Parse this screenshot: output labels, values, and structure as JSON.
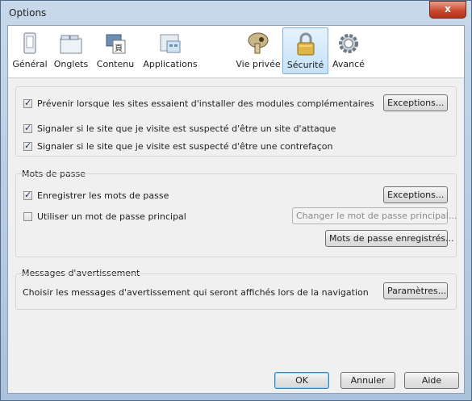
{
  "window": {
    "title": "Options",
    "close_glyph": "x"
  },
  "tabs": [
    {
      "label": "Général",
      "icon": "general-icon"
    },
    {
      "label": "Onglets",
      "icon": "tabs-icon"
    },
    {
      "label": "Contenu",
      "icon": "content-icon"
    },
    {
      "label": "Applications",
      "icon": "applications-icon"
    },
    {
      "label": "Vie privée",
      "icon": "privacy-mask-icon"
    },
    {
      "label": "Sécurité",
      "icon": "padlock-icon",
      "selected": true
    },
    {
      "label": "Avancé",
      "icon": "gear-icon"
    }
  ],
  "security": {
    "warn_addons": {
      "label": "Prévenir lorsque les sites essaient d'installer des modules complémentaires",
      "checked": true
    },
    "exceptions1": "Exceptions...",
    "attack_site": {
      "label": "Signaler si le site que je visite est suspecté d'être un site d'attaque",
      "checked": true
    },
    "forgery_site": {
      "label": "Signaler si le site que je visite est suspecté d'être une contrefaçon",
      "checked": true
    }
  },
  "passwords": {
    "group_label": "Mots de passe",
    "remember": {
      "label": "Enregistrer les mots de passe",
      "checked": true
    },
    "exceptions2": "Exceptions...",
    "master": {
      "label": "Utiliser un mot de passe principal",
      "checked": false
    },
    "change_master": "Changer le mot de passe principal...",
    "saved_passwords": "Mots de passe enregistrés..."
  },
  "warnings": {
    "group_label": "Messages d'avertissement",
    "description": "Choisir les messages d'avertissement qui seront affichés lors de la navigation",
    "settings_button": "Paramètres..."
  },
  "footer": {
    "ok": "OK",
    "cancel": "Annuler",
    "help": "Aide"
  },
  "colors": {
    "selected_tab": "#c6e2f8",
    "title_bar": "#aac2dc",
    "close": "#c8452a"
  }
}
